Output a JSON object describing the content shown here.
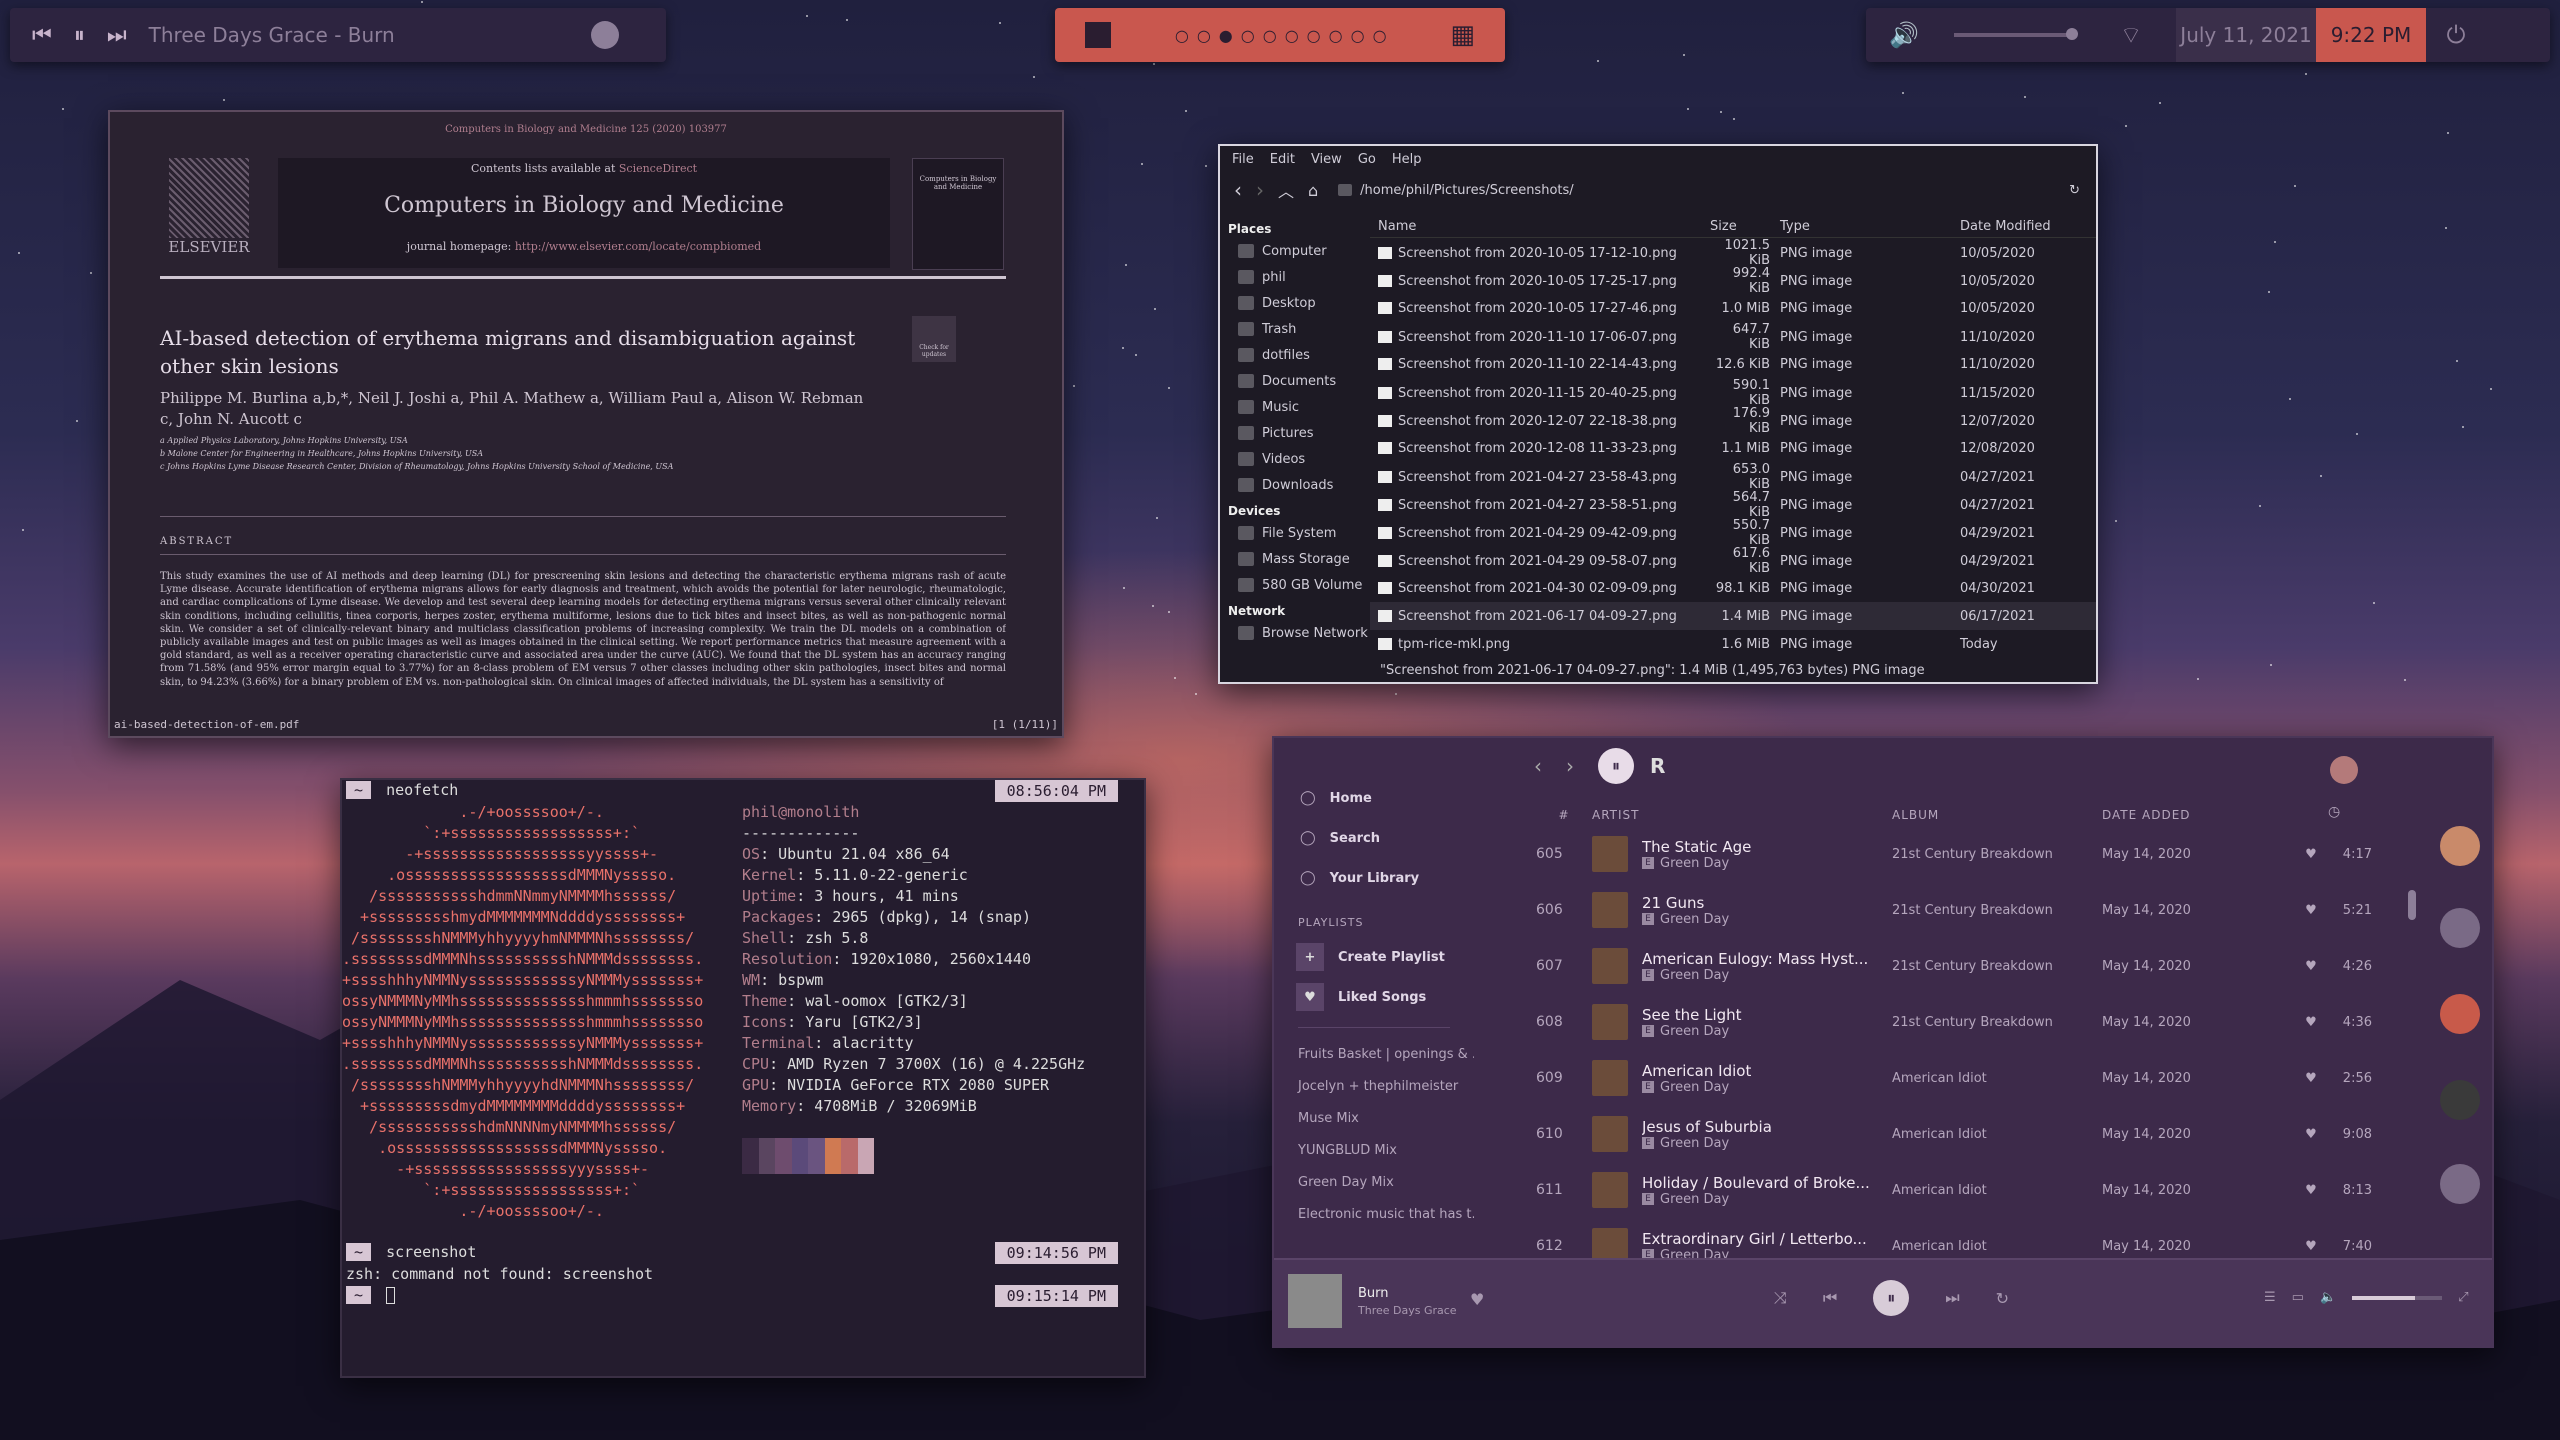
{
  "bar": {
    "track": "Three Days Grace - Burn",
    "date": "July 11, 2021",
    "time": "9:22 PM",
    "workspaces": [
      "○",
      "○",
      "●",
      "○",
      "○",
      "○",
      "○",
      "○",
      "○",
      "○"
    ]
  },
  "pdf": {
    "journal_ref": "Computers in Biology and Medicine 125 (2020) 103977",
    "contents": "Contents lists available at ",
    "contents_link": "ScienceDirect",
    "journal": "Computers in Biology and Medicine",
    "homepage": "journal homepage: ",
    "homepage_link": "http://www.elsevier.com/locate/compbiomed",
    "publisher": "ELSEVIER",
    "cover_text": "Computers in Biology and Medicine",
    "check_updates": "Check for updates",
    "title": "AI-based detection of erythema migrans and disambiguation against other skin lesions",
    "authors": "Philippe M. Burlina a,b,*, Neil J. Joshi a, Phil A. Mathew a, William Paul a, Alison W. Rebman c, John N. Aucott c",
    "affiliations": [
      "a Applied Physics Laboratory, Johns Hopkins University, USA",
      "b Malone Center for Engineering in Healthcare, Johns Hopkins University, USA",
      "c Johns Hopkins Lyme Disease Research Center, Division of Rheumatology, Johns Hopkins University School of Medicine, USA"
    ],
    "abstract_label": "ABSTRACT",
    "abstract": "This study examines the use of AI methods and deep learning (DL) for prescreening skin lesions and detecting the characteristic erythema migrans rash of acute Lyme disease. Accurate identification of erythema migrans allows for early diagnosis and treatment, which avoids the potential for later neurologic, rheumatologic, and cardiac complications of Lyme disease. We develop and test several deep learning models for detecting erythema migrans versus several other clinically relevant skin conditions, including cellulitis, tinea corporis, herpes zoster, erythema multiforme, lesions due to tick bites and insect bites, as well as non-pathogenic normal skin. We consider a set of clinically-relevant binary and multiclass classification problems of increasing complexity. We train the DL models on a combination of publicly available images and test on public images as well as images obtained in the clinical setting. We report performance metrics that measure agreement with a gold standard, as well as a receiver operating characteristic curve and associated area under the curve (AUC). We found that the DL system has an accuracy ranging from 71.58% (and 95% error margin equal to 3.77%) for an 8-class problem of EM versus 7 other classes including other skin pathologies, insect bites and normal skin, to 94.23% (3.66%) for a binary problem of EM vs. non-pathological skin. On clinical images of affected individuals, the DL system has a sensitivity of",
    "filename": "ai-based-detection-of-em.pdf",
    "pages": "[1 (1/11)]"
  },
  "fm": {
    "menu": [
      "File",
      "Edit",
      "View",
      "Go",
      "Help"
    ],
    "path": "/home/phil/Pictures/Screenshots/",
    "places_label": "Places",
    "places": [
      "Computer",
      "phil",
      "Desktop",
      "Trash",
      "dotfiles",
      "Documents",
      "Music",
      "Pictures",
      "Videos",
      "Downloads"
    ],
    "devices_label": "Devices",
    "devices": [
      "File System",
      "Mass Storage",
      "580 GB Volume"
    ],
    "network_label": "Network",
    "network": [
      "Browse Network"
    ],
    "columns": [
      "Name",
      "Size",
      "Type",
      "Date Modified"
    ],
    "rows": [
      [
        "Screenshot from 2020-10-05 17-12-10.png",
        "1021.5 KiB",
        "PNG image",
        "10/05/2020"
      ],
      [
        "Screenshot from 2020-10-05 17-25-17.png",
        "992.4 KiB",
        "PNG image",
        "10/05/2020"
      ],
      [
        "Screenshot from 2020-10-05 17-27-46.png",
        "1.0 MiB",
        "PNG image",
        "10/05/2020"
      ],
      [
        "Screenshot from 2020-11-10 17-06-07.png",
        "647.7 KiB",
        "PNG image",
        "11/10/2020"
      ],
      [
        "Screenshot from 2020-11-10 22-14-43.png",
        "12.6 KiB",
        "PNG image",
        "11/10/2020"
      ],
      [
        "Screenshot from 2020-11-15 20-40-25.png",
        "590.1 KiB",
        "PNG image",
        "11/15/2020"
      ],
      [
        "Screenshot from 2020-12-07 22-18-38.png",
        "176.9 KiB",
        "PNG image",
        "12/07/2020"
      ],
      [
        "Screenshot from 2020-12-08 11-33-23.png",
        "1.1 MiB",
        "PNG image",
        "12/08/2020"
      ],
      [
        "Screenshot from 2021-04-27 23-58-43.png",
        "653.0 KiB",
        "PNG image",
        "04/27/2021"
      ],
      [
        "Screenshot from 2021-04-27 23-58-51.png",
        "564.7 KiB",
        "PNG image",
        "04/27/2021"
      ],
      [
        "Screenshot from 2021-04-29 09-42-09.png",
        "550.7 KiB",
        "PNG image",
        "04/29/2021"
      ],
      [
        "Screenshot from 2021-04-29 09-58-07.png",
        "617.6 KiB",
        "PNG image",
        "04/29/2021"
      ],
      [
        "Screenshot from 2021-04-30 02-09-09.png",
        "98.1 KiB",
        "PNG image",
        "04/30/2021"
      ],
      [
        "Screenshot from 2021-06-17 04-09-27.png",
        "1.4 MiB",
        "PNG image",
        "06/17/2021"
      ],
      [
        "tpm-rice-mkl.png",
        "1.6 MiB",
        "PNG image",
        "Today"
      ]
    ],
    "status": "\"Screenshot from 2021-06-17 04-09-27.png\": 1.4 MiB (1,495,763 bytes) PNG image"
  },
  "term": {
    "prompt": "~",
    "cmd1": "neofetch",
    "ts1": "08:56:04 PM",
    "logo": [
      "             .-/+oossssoo+/-.",
      "         `:+ssssssssssssssssss+:`",
      "       -+ssssssssssssssssssyyssss+-",
      "     .ossssssssssssssssssdMMMNysssso.",
      "   /ssssssssssshdmmNNmmyNMMMMhssssss/",
      "  +ssssssssshmydMMMMMMMNddddyssssssss+",
      " /sssssssshNMMMyhhyyyyhmNMMMNhssssssss/",
      ".ssssssssdMMMNhsssssssssshNMMMdssssssss.",
      "+sssshhhyNMMNyssssssssssssyNMMMysssssss+",
      "ossyNMMMNyMMhsssssssssssssshmmmhssssssso",
      "ossyNMMMNyMMhsssssssssssssshmmmhssssssso",
      "+sssshhhyNMMNyssssssssssssyNMMMysssssss+",
      ".ssssssssdMMMNhsssssssssshNMMMdssssssss.",
      " /sssssssshNMMMyhhyyyyhdNMMMNhssssssss/",
      "  +sssssssssdmydMMMMMMMMddddyssssssss+",
      "   /ssssssssssshdmNNNNmyNMMMMhssssss/",
      "    .ossssssssssssssssssdMMMNysssso.",
      "      -+sssssssssssssssssyyyssss+-",
      "         `:+ssssssssssssssssss+:`",
      "             .-/+oossssoo+/-."
    ],
    "user": "phil",
    "host": "monolith",
    "sep": "-------------",
    "info": [
      [
        "OS",
        "Ubuntu 21.04 x86_64"
      ],
      [
        "Kernel",
        "5.11.0-22-generic"
      ],
      [
        "Uptime",
        "3 hours, 41 mins"
      ],
      [
        "Packages",
        "2965 (dpkg), 14 (snap)"
      ],
      [
        "Shell",
        "zsh 5.8"
      ],
      [
        "Resolution",
        "1920x1080, 2560x1440"
      ],
      [
        "WM",
        "bspwm"
      ],
      [
        "Theme",
        "wal-oomox [GTK2/3]"
      ],
      [
        "Icons",
        "Yaru [GTK2/3]"
      ],
      [
        "Terminal",
        "alacritty"
      ],
      [
        "CPU",
        "AMD Ryzen 7 3700X (16) @ 4.225GHz"
      ],
      [
        "GPU",
        "NVIDIA GeForce RTX 2080 SUPER"
      ],
      [
        "Memory",
        "4708MiB / 32069MiB"
      ]
    ],
    "palette": [
      "#3b2a44",
      "#5a4560",
      "#6e4c6e",
      "#5b4a7a",
      "#6a5480",
      "#d07a52",
      "#b96a6a",
      "#c9a6b4"
    ],
    "cmd2": "screenshot",
    "ts2": "09:14:56 PM",
    "err": "zsh: command not found: screenshot",
    "ts3": "09:15:14 PM"
  },
  "spotify": {
    "nav": [
      "Home",
      "Search",
      "Your Library"
    ],
    "playlists_label": "PLAYLISTS",
    "create": "Create Playlist",
    "liked": "Liked Songs",
    "playlists": [
      "Fruits Basket | openings & ...",
      "Jocelyn + thephilmeister",
      "Muse Mix",
      "YUNGBLUD Mix",
      "Green Day Mix",
      "Electronic music that has t..."
    ],
    "headers": [
      "#",
      "ARTIST",
      "ALBUM",
      "DATE ADDED"
    ],
    "rows": [
      [
        "605",
        "The Static Age",
        "Green Day",
        "21st Century Breakdown",
        "May 14, 2020",
        "4:17"
      ],
      [
        "606",
        "21 Guns",
        "Green Day",
        "21st Century Breakdown",
        "May 14, 2020",
        "5:21"
      ],
      [
        "607",
        "American Eulogy: Mass Hyst...",
        "Green Day",
        "21st Century Breakdown",
        "May 14, 2020",
        "4:26"
      ],
      [
        "608",
        "See the Light",
        "Green Day",
        "21st Century Breakdown",
        "May 14, 2020",
        "4:36"
      ],
      [
        "609",
        "American Idiot",
        "Green Day",
        "American Idiot",
        "May 14, 2020",
        "2:56"
      ],
      [
        "610",
        "Jesus of Suburbia",
        "Green Day",
        "American Idiot",
        "May 14, 2020",
        "9:08"
      ],
      [
        "611",
        "Holiday / Boulevard of Broke...",
        "Green Day",
        "American Idiot",
        "May 14, 2020",
        "8:13"
      ],
      [
        "612",
        "Extraordinary Girl / Letterbo...",
        "Green Day",
        "American Idiot",
        "May 14, 2020",
        "7:40"
      ]
    ],
    "explicit": "E",
    "np_title": "Burn",
    "np_artist": "Three Days Grace",
    "header_letter": "R",
    "volume": 0.7
  }
}
